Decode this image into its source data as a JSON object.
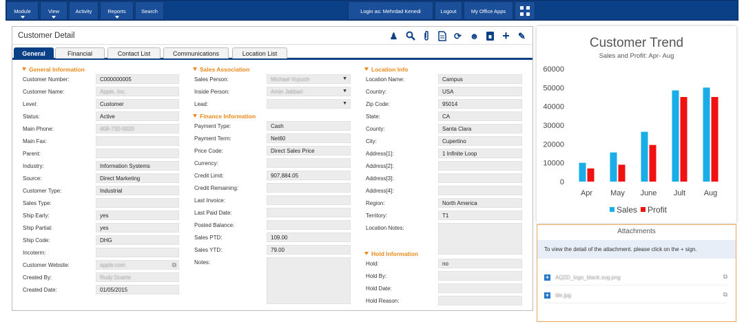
{
  "nav": {
    "items": [
      {
        "label": "Module",
        "caret": true
      },
      {
        "label": "View",
        "caret": true
      },
      {
        "label": "Activity",
        "caret": false
      },
      {
        "label": "Reports",
        "caret": true
      },
      {
        "label": "Search",
        "caret": false
      }
    ],
    "login_label": "Login as: Mehrdad Kenedi",
    "logout_label": "Logout",
    "office_apps_label": "My Office Apps",
    "grid_icon": "grid-icon"
  },
  "panel": {
    "title": "Customer Detail",
    "toolbar_icons": [
      "user-search-icon",
      "search-icon",
      "paperclip-icon",
      "document-icon",
      "sync-icon",
      "contact-icon",
      "lock-icon",
      "plus-icon",
      "pencil-icon"
    ]
  },
  "tabs": [
    "General",
    "Financial",
    "Contact List",
    "Communications",
    "Location List"
  ],
  "general": {
    "heading": "General Information",
    "fields": [
      {
        "label": "Customer Number:",
        "value": "C000000005"
      },
      {
        "label": "Customer Name:",
        "value": "Apple, Inc."
      },
      {
        "label": "Level:",
        "value": "Customer"
      },
      {
        "label": "Status:",
        "value": "Active"
      },
      {
        "label": "Main Phone:",
        "value": "408-732-0020"
      },
      {
        "label": "Main Fax:",
        "value": ""
      },
      {
        "label": "Parent:",
        "value": ""
      },
      {
        "label": "Industry:",
        "value": "Information Systems"
      },
      {
        "label": "Source:",
        "value": "Direct Marketing"
      },
      {
        "label": "Customer Type:",
        "value": "Industrial"
      },
      {
        "label": "Sales Type:",
        "value": ""
      },
      {
        "label": "Ship Early:",
        "value": "yes"
      },
      {
        "label": "Ship Partial:",
        "value": "yes"
      },
      {
        "label": "Ship Code:",
        "value": "DHG"
      },
      {
        "label": "Incoterm:",
        "value": ""
      },
      {
        "label": "Customer Website:",
        "value": "apple.com"
      },
      {
        "label": "Created By:",
        "value": "Rudy Duarte"
      },
      {
        "label": "Created Date:",
        "value": "01/05/2015"
      }
    ]
  },
  "sales": {
    "heading": "Sales Association",
    "fields": [
      {
        "label": "Sales Person:",
        "value": "Michael Vuyuch"
      },
      {
        "label": "Inside Person:",
        "value": "Amin Jabbari"
      },
      {
        "label": "Lead:",
        "value": ""
      }
    ]
  },
  "finance": {
    "heading": "Finance Information",
    "fields": [
      {
        "label": "Payment Type:",
        "value": "Cash"
      },
      {
        "label": "Payment Term:",
        "value": "Net60"
      },
      {
        "label": "Price Code:",
        "value": "Direct Sales Price"
      },
      {
        "label": "Currency:",
        "value": ""
      },
      {
        "label": "Credit Limit:",
        "value": "907,884.05"
      },
      {
        "label": "Credit Remaining:",
        "value": ""
      },
      {
        "label": "Last Invoice:",
        "value": ""
      },
      {
        "label": "Last Paid Date:",
        "value": ""
      },
      {
        "label": "Posted Balance:",
        "value": ""
      },
      {
        "label": "Sales PTD:",
        "value": "109.00"
      },
      {
        "label": "Sales YTD:",
        "value": "79.00"
      },
      {
        "label": "Notes:",
        "value": ""
      }
    ]
  },
  "location": {
    "heading": "Location Info",
    "fields": [
      {
        "label": "Location Name:",
        "value": "Campus"
      },
      {
        "label": "Country:",
        "value": "USA"
      },
      {
        "label": "Zip Code:",
        "value": "95014"
      },
      {
        "label": "State:",
        "value": "CA"
      },
      {
        "label": "County:",
        "value": "Santa Clara"
      },
      {
        "label": "City:",
        "value": "Cupertino"
      },
      {
        "label": "Address[1]:",
        "value": "1 Infinite Loop"
      },
      {
        "label": "Address[2]:",
        "value": ""
      },
      {
        "label": "Address[3]:",
        "value": ""
      },
      {
        "label": "Address[4]:",
        "value": ""
      },
      {
        "label": "Region:",
        "value": "North America"
      },
      {
        "label": "Territory:",
        "value": "T1"
      },
      {
        "label": "Location Notes:",
        "value": ""
      }
    ]
  },
  "hold": {
    "heading": "Hold Information",
    "fields": [
      {
        "label": "Hold:",
        "value": "no"
      },
      {
        "label": "Hold By:",
        "value": ""
      },
      {
        "label": "Hold Date:",
        "value": ""
      },
      {
        "label": "Hold Reason:",
        "value": ""
      }
    ]
  },
  "chart_data": {
    "type": "bar",
    "title": "Customer Trend",
    "subtitle": "Sales and Profit: Apr- Aug",
    "categories": [
      "Apr",
      "May",
      "June",
      "Jult",
      "Aug"
    ],
    "series": [
      {
        "name": "Sales",
        "color": "#1aaee8",
        "values": [
          10000,
          15500,
          26500,
          48500,
          50000
        ]
      },
      {
        "name": "Profit",
        "color": "#f21111",
        "values": [
          7000,
          9000,
          19500,
          45000,
          45000
        ]
      }
    ],
    "ylim": [
      0,
      60000
    ],
    "yticks": [
      0,
      10000,
      20000,
      30000,
      40000,
      50000,
      60000
    ],
    "grid": false,
    "legend": "bottom-center"
  },
  "attachments": {
    "heading": "Attachments",
    "note": "To view the detail of the attachment. please click on the + sign.",
    "files": [
      "AQ2D_logo_black.svg.png",
      "tile.jpg"
    ]
  }
}
